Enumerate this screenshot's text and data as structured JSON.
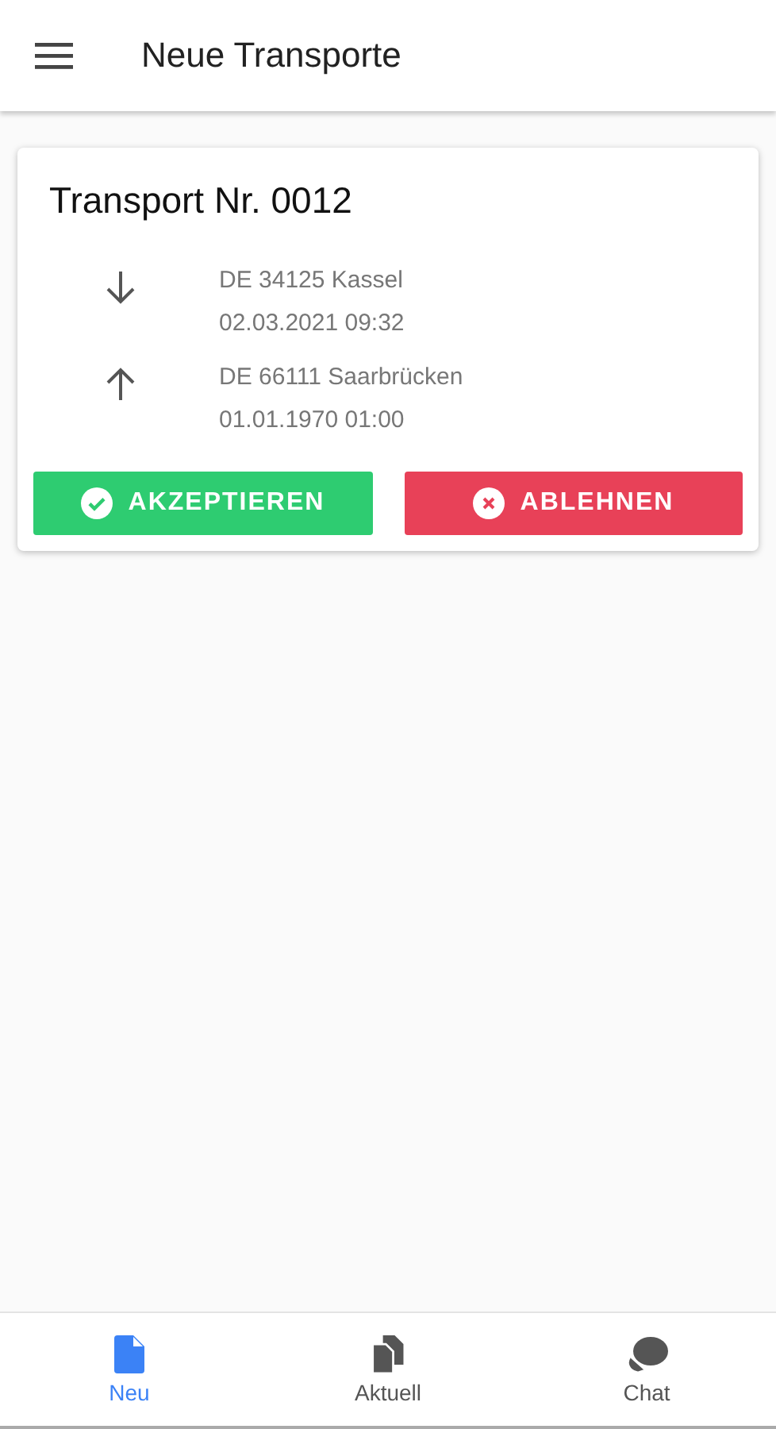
{
  "app_bar": {
    "title": "Neue Transporte"
  },
  "card": {
    "title": "Transport Nr. 0012",
    "stops": [
      {
        "kind": "down",
        "place": "DE 34125 Kassel",
        "time": "02.03.2021 09:32"
      },
      {
        "kind": "up",
        "place": "DE 66111 Saarbrücken",
        "time": "01.01.1970 01:00"
      }
    ],
    "buttons": [
      {
        "kind": "accept",
        "label": "AKZEPTIEREN"
      },
      {
        "kind": "reject",
        "label": "ABLEHNEN"
      }
    ]
  },
  "bottom_nav": [
    {
      "kind": "file",
      "label": "Neu",
      "selected": true
    },
    {
      "kind": "files",
      "label": "Aktuell",
      "selected": false
    },
    {
      "kind": "chat",
      "label": "Chat",
      "selected": false
    }
  ]
}
